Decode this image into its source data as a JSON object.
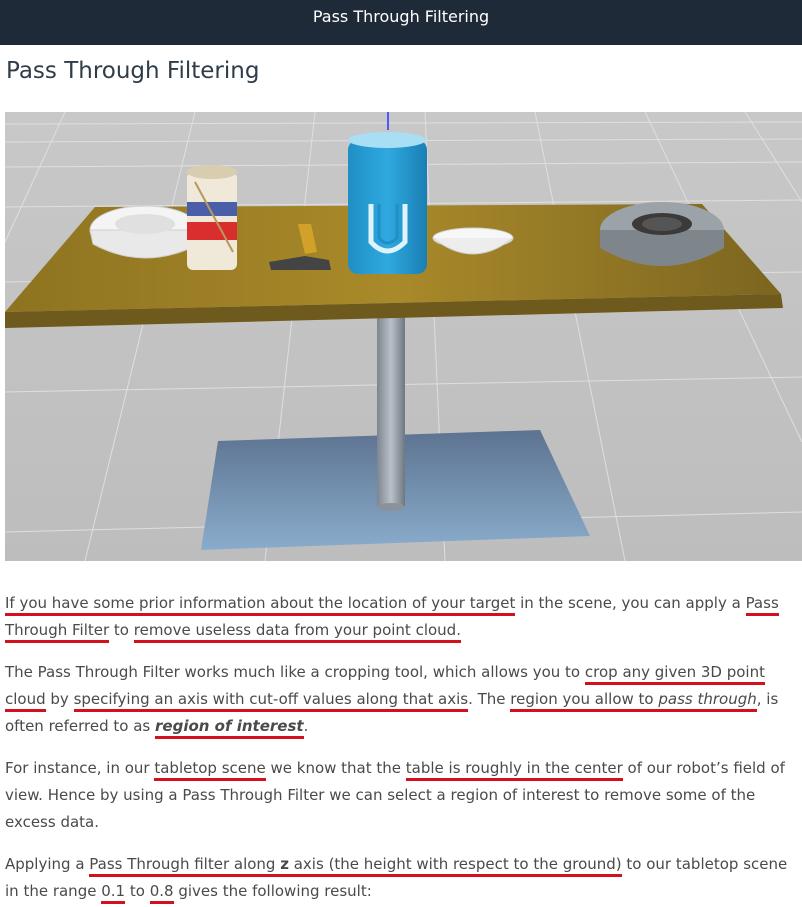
{
  "header": {
    "title": "Pass Through Filtering"
  },
  "page": {
    "title": "Pass Through Filtering"
  },
  "image": {
    "description_icon": "tabletop-scene-render"
  },
  "paragraphs": {
    "p1": {
      "s1": "If you have some prior information about the location of your target",
      "s2": " in the scene, you can apply a ",
      "s3": "Pass Through Filter",
      "s4": " to ",
      "s5": "remove useless data from your point cloud."
    },
    "p2": {
      "s1": "The Pass Through Filter works much like a cropping tool, which allows you to ",
      "s2": "crop any given 3D point cloud",
      "s3": " by ",
      "s4": "specifying an axis with cut-off values along that axis",
      "s5": ". The ",
      "s6": "region you allow to ",
      "s7": "pass through",
      "s8": ", is often referred to as ",
      "s9": "region of interest",
      "s10": "."
    },
    "p3": {
      "s1": "For instance, in our ",
      "s2": "tabletop scene",
      "s3": " we know that the ",
      "s4": "table is roughly in the center",
      "s5": " of our robot’s field of view. Hence by using a Pass Through Filter we can select a region of interest to remove some of the excess data."
    },
    "p4": {
      "s1": "Applying a ",
      "s2a": "Pass Through filter along ",
      "s2b": "z",
      "s2c": " axis",
      "s3": " (the height with respect to the ground)",
      "s4": " to our tabletop scene in the range ",
      "s5": "0.1",
      "s6": " to ",
      "s7": "0.8",
      "s8": " gives the following result:"
    }
  },
  "colors": {
    "header_bg": "#1e2a38",
    "underline": "#d3111e",
    "text": "#4a4a4a"
  }
}
